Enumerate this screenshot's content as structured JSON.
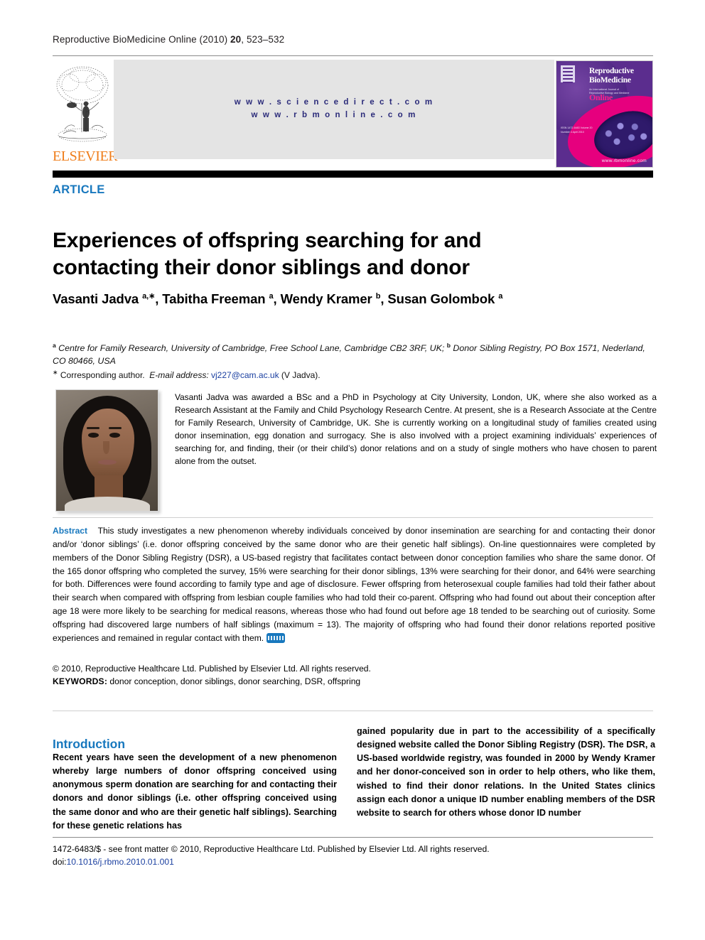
{
  "running_head": {
    "journal": "Reproductive BioMedicine Online (2010) ",
    "volume": "20",
    "pages": ", 523–532"
  },
  "masthead": {
    "publisher_name": "ELSEVIER",
    "tree_logo": "elsevier-tree-logo",
    "url_sciencedirect": "w w w . s c i e n c e d i r e c t . c o m",
    "url_rbmonline": "w w w . r b m o n l i n e . c o m",
    "cover": {
      "line1": "Reproductive",
      "line2": "BioMedicine",
      "line3": "Online",
      "subtitle": "An International Journal of Reproductive Biology and Medicine",
      "left_note": "ISSN 1472-6483  Volume 20  Number 4  April 2010",
      "url": "www.rbmonline.com"
    }
  },
  "article": {
    "label": "ARTICLE",
    "title": "Experiences of offspring searching for and contacting their donor siblings and donor",
    "authors_html": "Vasanti Jadva <sup>a,∗</sup>, Tabitha Freeman <sup>a</sup>, Wendy Kramer <sup>b</sup>, Susan Golombok <sup>a</sup>",
    "affiliation_html": "<sup>a</sup> Centre for Family Research, University of Cambridge, Free School Lane, Cambridge CB2 3RF, UK; <sup>b</sup> Donor Sibling Registry, PO Box 1571, Nederland, CO 80466, USA",
    "corresponding_html": "<sup>∗</sup> Corresponding author. &nbsp;<i>E-mail address:</i> <a class=\"mail\" href=\"#\">vj227@cam.ac.uk</a> (V Jadva).",
    "author_photo": "author-portrait-vasanti-jadva",
    "bio": "Vasanti Jadva was awarded a BSc and a PhD in Psychology at City University, London, UK, where she also worked as a Research Assistant at the Family and Child Psychology Research Centre. At present, she is a Research Associate at the Centre for Family Research, University of Cambridge, UK. She is currently working on a longitudinal study of families created using donor insemination, egg donation and surrogacy. She is also involved with a project examining individuals’ experiences of searching for, and finding, their (or their child’s) donor relations and on a study of single mothers who have chosen to parent alone from the outset."
  },
  "abstract": {
    "label": "Abstract",
    "text": "This study investigates a new phenomenon whereby individuals conceived by donor insemination are searching for and contacting their donor and/or ‘donor siblings’ (i.e. donor offspring conceived by the same donor who are their genetic half siblings). On-line questionnaires were completed by members of the Donor Sibling Registry (DSR), a US-based registry that facilitates contact between donor conception families who share the same donor. Of the 165 donor offspring who completed the survey, 15% were searching for their donor siblings, 13% were searching for their donor, and 64% were searching for both. Differences were found according to family type and age of disclosure. Fewer offspring from heterosexual couple families had told their father about their search when compared with offspring from lesbian couple families who had told their co-parent. Offspring who had found out about their conception after age 18 were more likely to be searching for medical reasons, whereas those who had found out before age 18 tended to be searching out of curiosity. Some offspring had discovered large numbers of half siblings (maximum = 13). The majority of offspring who had found their donor relations reported positive experiences and remained in regular contact with them.",
    "badge": "rbm-online-badge",
    "copyright": "© 2010, Reproductive Healthcare Ltd. Published by Elsevier Ltd. All rights reserved.",
    "keywords_label": "KEYWORDS:",
    "keywords": " donor conception, donor siblings, donor searching, DSR, offspring"
  },
  "body": {
    "section_heading": "Introduction",
    "column_left": "Recent years have seen the development of a new phenomenon whereby large numbers of donor offspring conceived using anonymous sperm donation are searching for and contacting their donors and donor siblings (i.e. other offspring conceived using the same donor and who are their genetic half siblings). Searching for these genetic relations has",
    "column_right": "gained popularity due in part to the accessibility of a specifically designed website called the Donor Sibling Registry (DSR). The DSR, a US-based worldwide registry, was founded in 2000 by Wendy Kramer and her donor-conceived son in order to help others, who like them, wished to find their donor relations. In the United States clinics assign each donor a unique ID number enabling members of the DSR website to search for others whose donor ID number"
  },
  "footer": {
    "front_matter": "1472-6483/$ - see front matter © 2010, Reproductive Healthcare Ltd. Published by Elsevier Ltd. All rights reserved.",
    "doi_prefix": "doi:",
    "doi": "10.1016/j.rbmo.2010.01.001"
  },
  "colors": {
    "accent_blue": "#1878be",
    "elsevier_orange": "#ef7d1a",
    "link_blue": "#1a3fa0",
    "sd_band": "#e4e4e4"
  }
}
